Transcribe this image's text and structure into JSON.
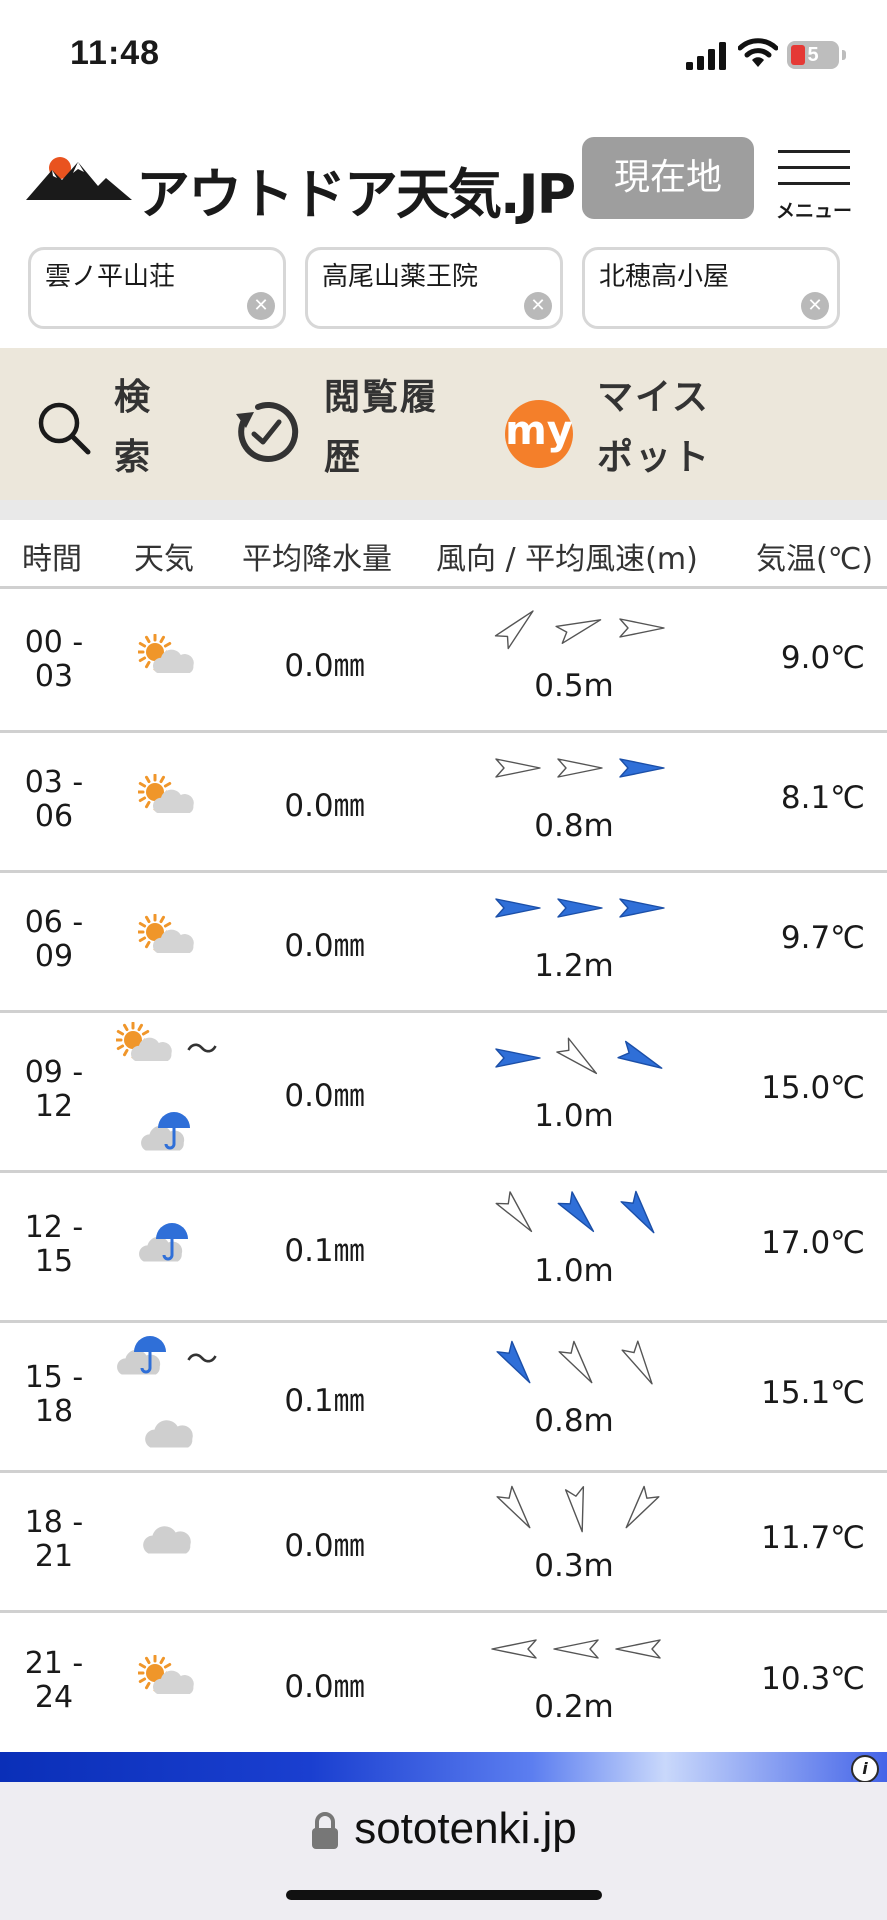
{
  "status": {
    "time": "11:48",
    "battery": "5"
  },
  "header": {
    "logo_text": "アウトドア天気.JP",
    "location_button": "現在地",
    "menu_label": "メニュー"
  },
  "history": [
    {
      "label": "雲ノ平山荘"
    },
    {
      "label": "高尾山薬王院"
    },
    {
      "label": "北穂高小屋"
    }
  ],
  "tools": {
    "search": {
      "line1": "検",
      "line2": "索"
    },
    "history": {
      "line1": "閲覧履",
      "line2": "歴"
    },
    "myspot": {
      "badge": "my",
      "line1": "マイス",
      "line2": "ポット"
    }
  },
  "table": {
    "headers": {
      "time": "時間",
      "weather": "天気",
      "rain": "平均降水量",
      "wind": "風向 / 平均風速(m)",
      "temp": "気温(℃)"
    },
    "rows": [
      {
        "from": "00 -",
        "to": "03",
        "weather": [
          "sun-cloud-icon"
        ],
        "rain": "0.0㎜",
        "speed": "0.5m",
        "temp": "9.0℃",
        "wind": [
          {
            "deg": 45,
            "fill": "none"
          },
          {
            "deg": 70,
            "fill": "none"
          },
          {
            "deg": 90,
            "fill": "none"
          }
        ]
      },
      {
        "from": "03 -",
        "to": "06",
        "weather": [
          "sun-cloud-icon"
        ],
        "rain": "0.0㎜",
        "speed": "0.8m",
        "temp": "8.1℃",
        "wind": [
          {
            "deg": 90,
            "fill": "none"
          },
          {
            "deg": 90,
            "fill": "none"
          },
          {
            "deg": 90,
            "fill": "blue"
          }
        ]
      },
      {
        "from": "06 -",
        "to": "09",
        "weather": [
          "sun-cloud-icon"
        ],
        "rain": "0.0㎜",
        "speed": "1.2m",
        "temp": "9.7℃",
        "wind": [
          {
            "deg": 90,
            "fill": "blue"
          },
          {
            "deg": 90,
            "fill": "blue"
          },
          {
            "deg": 90,
            "fill": "blue"
          }
        ]
      },
      {
        "from": "09 -",
        "to": "12",
        "weather": [
          "sun-cloud-icon",
          "umbrella-cloud-icon"
        ],
        "rain": "0.0㎜",
        "speed": "1.0m",
        "temp": "15.0℃",
        "wind": [
          {
            "deg": 90,
            "fill": "blue"
          },
          {
            "deg": 130,
            "fill": "none"
          },
          {
            "deg": 115,
            "fill": "blue"
          }
        ]
      },
      {
        "from": "12 -",
        "to": "15",
        "weather": [
          "umbrella-cloud-icon"
        ],
        "rain": "0.1㎜",
        "speed": "1.0m",
        "temp": "17.0℃",
        "wind": [
          {
            "deg": 140,
            "fill": "none"
          },
          {
            "deg": 140,
            "fill": "blue"
          },
          {
            "deg": 145,
            "fill": "blue"
          }
        ]
      },
      {
        "from": "15 -",
        "to": "18",
        "weather": [
          "umbrella-cloud-icon",
          "cloud-icon"
        ],
        "rain": "0.1㎜",
        "speed": "0.8m",
        "temp": "15.1℃",
        "wind": [
          {
            "deg": 145,
            "fill": "blue"
          },
          {
            "deg": 145,
            "fill": "none"
          },
          {
            "deg": 150,
            "fill": "none"
          }
        ]
      },
      {
        "from": "18 -",
        "to": "21",
        "weather": [
          "cloud-icon"
        ],
        "rain": "0.0㎜",
        "speed": "0.3m",
        "temp": "11.7℃",
        "wind": [
          {
            "deg": 145,
            "fill": "none"
          },
          {
            "deg": 170,
            "fill": "none"
          },
          {
            "deg": 215,
            "fill": "none"
          }
        ]
      },
      {
        "from": "21 -",
        "to": "24",
        "weather": [
          "sun-cloud-icon"
        ],
        "rain": "0.0㎜",
        "speed": "0.2m",
        "temp": "10.3℃",
        "wind": [
          {
            "deg": 270,
            "fill": "none"
          },
          {
            "deg": 270,
            "fill": "none"
          },
          {
            "deg": 270,
            "fill": "none"
          }
        ]
      }
    ]
  },
  "browser": {
    "url": "sototenki.jp"
  },
  "colors": {
    "accent_blue": "#2f6fd8",
    "sun": "#f0962a",
    "band_bg": "#ece7db",
    "myspot_orange": "#f47f2a"
  }
}
